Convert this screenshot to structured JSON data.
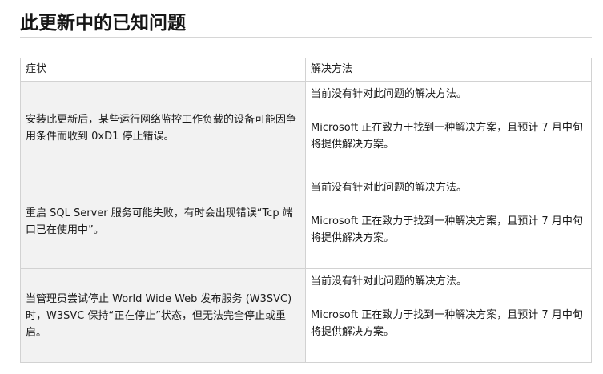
{
  "title": "此更新中的已知问题",
  "table": {
    "headers": [
      "症状",
      "解决方法"
    ],
    "rows": [
      {
        "symptom": "安装此更新后，某些运行网络监控工作负载的设备可能因争用条件而收到 0xD1 停止错误。",
        "workaround": [
          "当前没有针对此问题的解决方法。",
          "Microsoft 正在致力于找到一种解决方案，且预计 7 月中旬将提供解决方案。"
        ]
      },
      {
        "symptom": "重启 SQL Server 服务可能失败，有时会出现错误“Tcp 端口已在使用中”。",
        "workaround": [
          "当前没有针对此问题的解决方法。",
          "Microsoft 正在致力于找到一种解决方案，且预计 7 月中旬将提供解决方案。"
        ]
      },
      {
        "symptom": "当管理员尝试停止 World Wide Web 发布服务 (W3SVC) 时，W3SVC 保持“正在停止”状态，但无法完全停止或重启。",
        "workaround": [
          "当前没有针对此问题的解决方法。",
          "Microsoft 正在致力于找到一种解决方案，且预计 7 月中旬将提供解决方案。"
        ]
      }
    ]
  }
}
